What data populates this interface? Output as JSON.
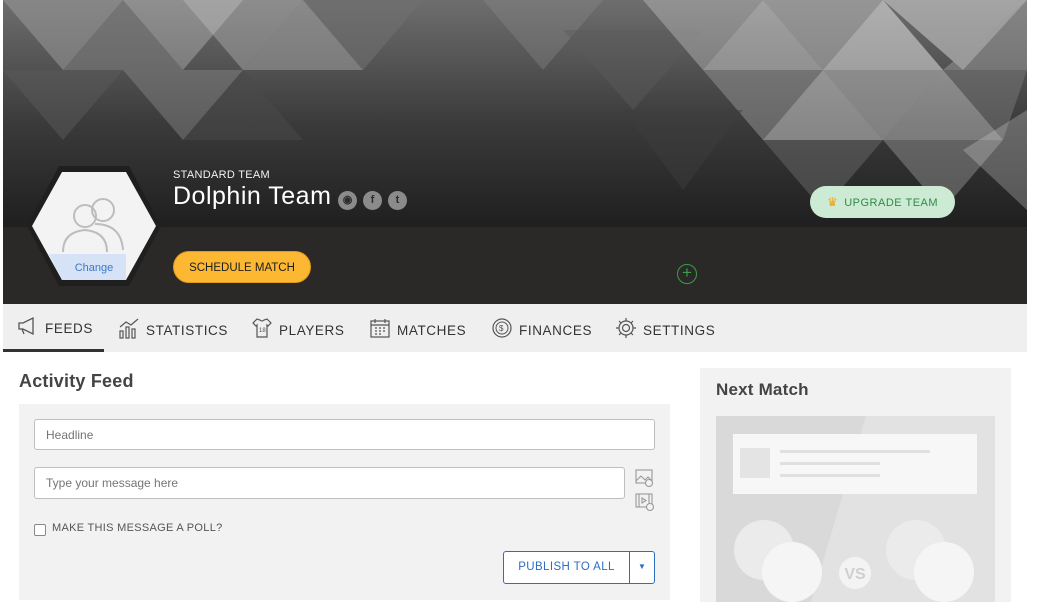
{
  "team": {
    "type_label": "STANDARD TEAM",
    "name": "Dolphin Team",
    "avatar_change_label": "Change"
  },
  "social_icons": [
    "globe-icon",
    "facebook-icon",
    "twitter-icon"
  ],
  "buttons": {
    "upgrade": "UPGRADE TEAM",
    "schedule": "SCHEDULE MATCH",
    "publish": "PUBLISH TO ALL"
  },
  "tabs": [
    {
      "label": "FEEDS",
      "icon": "megaphone-icon",
      "active": true
    },
    {
      "label": "STATISTICS",
      "icon": "bar-chart-icon",
      "active": false
    },
    {
      "label": "PLAYERS",
      "icon": "jersey-icon",
      "active": false
    },
    {
      "label": "MATCHES",
      "icon": "calendar-icon",
      "active": false
    },
    {
      "label": "FINANCES",
      "icon": "coin-icon",
      "active": false
    },
    {
      "label": "SETTINGS",
      "icon": "gear-icon",
      "active": false
    }
  ],
  "feed": {
    "title": "Activity Feed",
    "headline_placeholder": "Headline",
    "message_placeholder": "Type your message here",
    "poll_label": "MAKE THIS MESSAGE A POLL?"
  },
  "next_match": {
    "title": "Next Match",
    "vs_label": "VS"
  },
  "colors": {
    "accent_yellow": "#fdb833",
    "upgrade_green": "#cdebd4",
    "link_blue": "#2c6fc2"
  }
}
